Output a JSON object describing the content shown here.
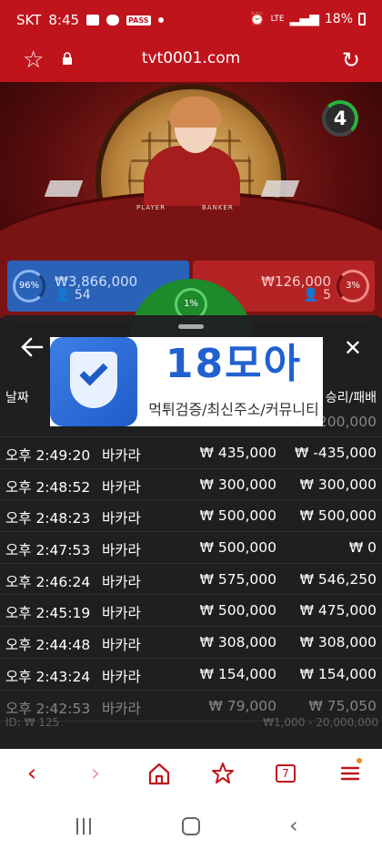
{
  "status_bar": {
    "carrier": "SKT",
    "time": "8:45",
    "pass_badge": "PASS",
    "network": "LTE",
    "battery": "18%"
  },
  "browser": {
    "url": "tvt0001.com"
  },
  "game": {
    "round_timer": "4",
    "table_labels": {
      "player": "PLAYER",
      "banker": "BANKER"
    },
    "player": {
      "percent": "96%",
      "amount": "₩3,866,000",
      "count": "54"
    },
    "tie": {
      "percent": "1%"
    },
    "banker": {
      "percent": "3%",
      "amount": "₩126,000",
      "count": "5"
    }
  },
  "history": {
    "header_date": "날짜",
    "header_result": "승리/패배",
    "rows": [
      {
        "time": "오후 2:49:20",
        "game": "바카라",
        "bet": "₩ 435,000",
        "payout": "₩ -435,000"
      },
      {
        "time": "오후 2:48:52",
        "game": "바카라",
        "bet": "₩ 300,000",
        "payout": "₩ 300,000"
      },
      {
        "time": "오후 2:48:23",
        "game": "바카라",
        "bet": "₩ 500,000",
        "payout": "₩ 500,000"
      },
      {
        "time": "오후 2:47:53",
        "game": "바카라",
        "bet": "₩ 500,000",
        "payout": "₩ 0"
      },
      {
        "time": "오후 2:46:24",
        "game": "바카라",
        "bet": "₩ 575,000",
        "payout": "₩ 546,250"
      },
      {
        "time": "오후 2:45:19",
        "game": "바카라",
        "bet": "₩ 500,000",
        "payout": "₩ 475,000"
      },
      {
        "time": "오후 2:44:48",
        "game": "바카라",
        "bet": "₩ 308,000",
        "payout": "₩ 308,000"
      },
      {
        "time": "오후 2:43:24",
        "game": "바카라",
        "bet": "₩ 154,000",
        "payout": "₩ 154,000"
      },
      {
        "time": "오후 2:42:53",
        "game": "바카라",
        "bet": "₩ 79,000",
        "payout": "₩ 75,050"
      }
    ],
    "hidden_row_payout": "200,000",
    "footer_ghost_left": "ID: ₩ 125",
    "footer_ghost_right": "₩1,000 - 20,000,000"
  },
  "watermark": {
    "title": "18모아",
    "subtitle": "먹튀검증/최신주소/커뮤니티"
  },
  "browser_nav": {
    "tabs_count": "7"
  },
  "colors": {
    "brand_red": "#c0141c",
    "player_blue": "#2a62b8",
    "banker_red": "#b52424",
    "tie_green": "#1d8a2c"
  }
}
